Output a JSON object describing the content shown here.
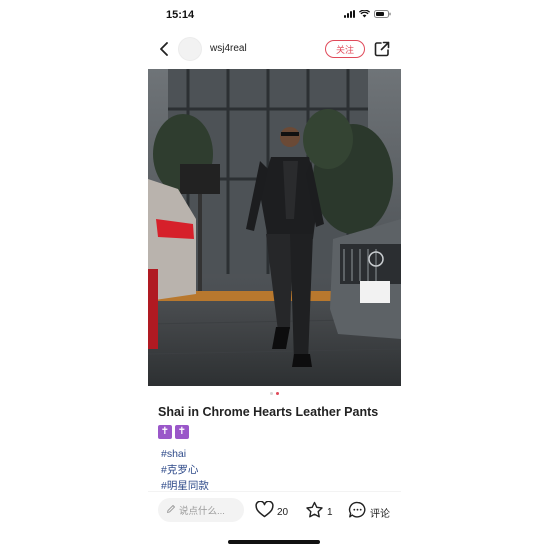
{
  "status_bar": {
    "time": "15:14"
  },
  "nav": {
    "username": "wsj4real",
    "follow_label": "关注"
  },
  "post": {
    "image_index": 2,
    "image_count": 2,
    "title": "Shai in Chrome Hearts Leather Pants",
    "emojis": [
      "✝",
      "✝"
    ],
    "tags": [
      "#shai",
      "#克罗心",
      "#明星同款"
    ]
  },
  "bottom_bar": {
    "comment_placeholder": "说点什么...",
    "like_count": "20",
    "collect_count": "1",
    "comment_label": "评论"
  },
  "colors": {
    "accent": "#e04a5a",
    "tag": "#2f4b8a",
    "emoji_bg": "#9a57c9"
  },
  "icons": [
    "back-icon",
    "share-icon",
    "edit-icon",
    "heart-icon",
    "star-icon",
    "comment-bubble-icon",
    "signal-icon",
    "wifi-icon",
    "battery-icon"
  ]
}
